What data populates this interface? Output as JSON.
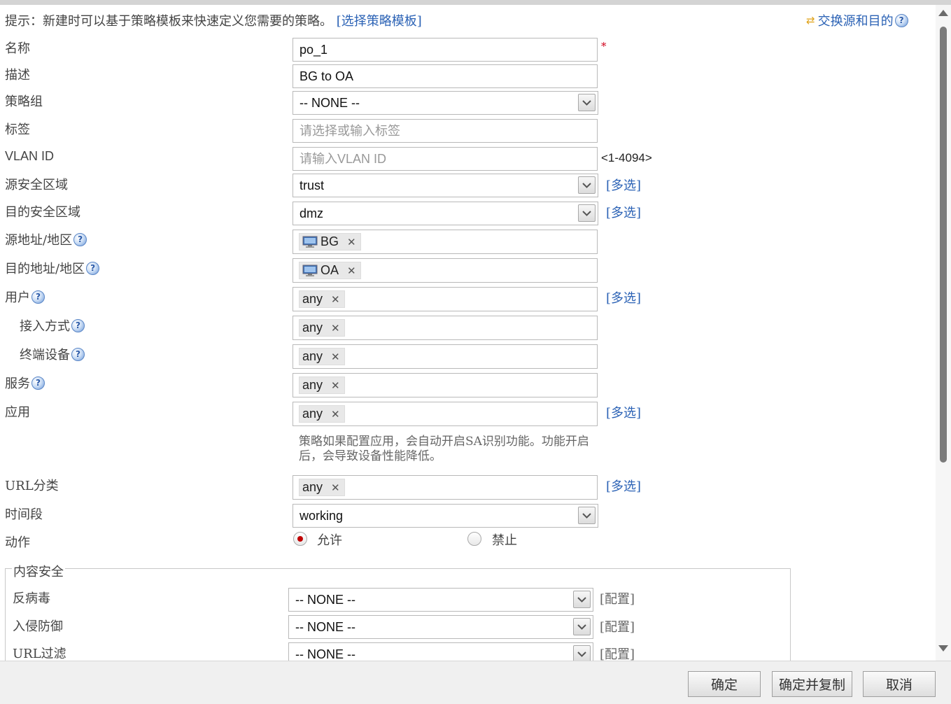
{
  "hint": {
    "text": "提示：新建时可以基于策略模板来快速定义您需要的策略。",
    "link": "[选择策略模板]"
  },
  "swap_link": "交换源和目的",
  "fields": {
    "name": {
      "label": "名称",
      "value": "po_1",
      "required_mark": "*"
    },
    "description": {
      "label": "描述",
      "value": "BG to OA"
    },
    "policy_group": {
      "label": "策略组",
      "value": "-- NONE --"
    },
    "tag": {
      "label": "标签",
      "placeholder": "请选择或输入标签"
    },
    "vlan_id": {
      "label": "VLAN ID",
      "placeholder": "请输入VLAN ID",
      "range": "<1-4094>"
    },
    "src_zone": {
      "label": "源安全区域",
      "value": "trust",
      "multi": "[多选]"
    },
    "dst_zone": {
      "label": "目的安全区域",
      "value": "dmz",
      "multi": "[多选]"
    },
    "src_addr": {
      "label": "源地址/地区",
      "tag": "BG"
    },
    "dst_addr": {
      "label": "目的地址/地区",
      "tag": "OA"
    },
    "user": {
      "label": "用户",
      "tag": "any",
      "multi": "[多选]"
    },
    "access_mode": {
      "label": "接入方式",
      "tag": "any"
    },
    "terminal_device": {
      "label": "终端设备",
      "tag": "any"
    },
    "service": {
      "label": "服务",
      "tag": "any"
    },
    "application": {
      "label": "应用",
      "tag": "any",
      "multi": "[多选]",
      "note": "策略如果配置应用，会自动开启SA识别功能。功能开启后，会导致设备性能降低。"
    },
    "url_category": {
      "label": "URL分类",
      "tag": "any",
      "multi": "[多选]"
    },
    "time_range": {
      "label": "时间段",
      "value": "working"
    },
    "action": {
      "label": "动作",
      "options": [
        "允许",
        "禁止"
      ],
      "selected": "允许"
    }
  },
  "content_security": {
    "legend": "内容安全",
    "rows": [
      {
        "label": "反病毒",
        "value": "-- NONE --",
        "config": "[配置]"
      },
      {
        "label": "入侵防御",
        "value": "-- NONE --",
        "config": "[配置]"
      },
      {
        "label": "URL过滤",
        "value": "-- NONE --",
        "config": "[配置]"
      }
    ]
  },
  "buttons": {
    "ok": "确定",
    "ok_copy": "确定并复制",
    "cancel": "取消"
  },
  "colors": {
    "link": "#2b62b5",
    "required": "#d0021b",
    "radio_selected": "#c00000"
  }
}
